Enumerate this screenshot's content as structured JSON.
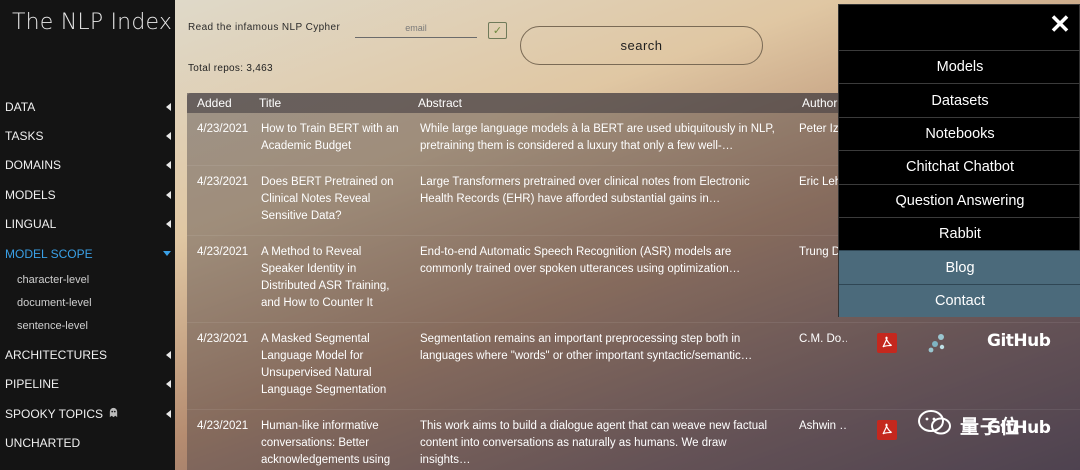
{
  "sidebar": {
    "logo": "The NLP Index",
    "items": [
      {
        "label": "DATA"
      },
      {
        "label": "TASKS"
      },
      {
        "label": "DOMAINS"
      },
      {
        "label": "MODELS"
      },
      {
        "label": "LINGUAL"
      },
      {
        "label": "MODEL SCOPE",
        "active": true,
        "children": [
          "character-level",
          "document-level",
          "sentence-level"
        ]
      },
      {
        "label": "ARCHITECTURES"
      },
      {
        "label": "PIPELINE"
      },
      {
        "label": "SPOOKY TOPICS",
        "icon": "ghost-icon"
      },
      {
        "label": "UNCHARTED"
      }
    ]
  },
  "header": {
    "cypher_label": "Read the infamous NLP Cypher",
    "email_placeholder": "email",
    "checkbox_mark": "✓",
    "search_label": "search",
    "total_repos": "Total repos: 3,463"
  },
  "table": {
    "columns": [
      "Added",
      "Title",
      "Abstract",
      "Author"
    ],
    "rows": [
      {
        "added": "4/23/2021",
        "title": "How to Train BERT with an Academic Budget",
        "abstract": "While large language models à la BERT are used ubiquitously in NLP, pretraining them is considered a luxury that only a few well-…",
        "author": "Peter Iz"
      },
      {
        "added": "4/23/2021",
        "title": "Does BERT Pretrained on Clinical Notes Reveal Sensitive Data?",
        "abstract": "Large Transformers pretrained over clinical notes from Electronic Health Records (EHR) have afforded substantial gains in…",
        "author": "Eric Leh"
      },
      {
        "added": "4/23/2021",
        "title": "A Method to Reveal Speaker Identity in Distributed ASR Training, and How to Counter It",
        "abstract": "End-to-end Automatic Speech Recognition (ASR) models are commonly trained over spoken utterances using optimization…",
        "author": "Trung D"
      },
      {
        "added": "4/23/2021",
        "title": "A Masked Segmental Language Model for Unsupervised Natural Language Segmentation",
        "abstract": "Segmentation remains an important preprocessing step both in languages where \"words\" or other important syntactic/semantic…",
        "author": "C.M. Do…",
        "pdf_icon": "pdf-icon",
        "paper_icon": "papers-with-code-icon",
        "github_label": "GitHub"
      },
      {
        "added": "4/23/2021",
        "title": "Human-like informative conversations: Better acknowledgements using",
        "abstract": "This work aims to build a dialogue agent that can weave new factual content into conversations as naturally as humans. We draw insights…",
        "author": "Ashwin …",
        "pdf_icon": "pdf-icon",
        "github_label": "GitHub"
      }
    ]
  },
  "menu": {
    "close_icon": "close-icon",
    "items": [
      {
        "label": "Models"
      },
      {
        "label": "Datasets"
      },
      {
        "label": "Notebooks"
      },
      {
        "label": "Chitchat Chatbot"
      },
      {
        "label": "Question Answering"
      },
      {
        "label": "Rabbit"
      },
      {
        "label": "Blog",
        "style": "alt"
      },
      {
        "label": "Contact",
        "style": "alt"
      }
    ]
  },
  "watermark": {
    "text": "量子位",
    "icon": "wechat-icon"
  },
  "colors": {
    "sidebar_bg": "#141414",
    "active_nav": "#3aa0e6",
    "menu_bg": "#000000",
    "menu_alt_bg": "#4b6a7b",
    "pdf_red": "#c4281e"
  }
}
